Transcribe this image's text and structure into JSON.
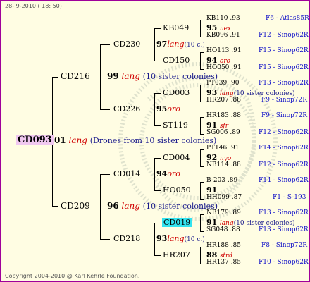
{
  "header": {
    "timestamp": "28- 9-2010 ( 18: 50)"
  },
  "footer": {
    "copyright": "Copyright 2004-2010 @ Karl Kehrle Foundation."
  },
  "root": {
    "id": "CD093",
    "num": "01",
    "race": "lang",
    "note": "(Drones from 10 sister colonies)"
  },
  "gen1": [
    {
      "id": "CD216",
      "num": "99",
      "race": "lang",
      "note": "(10 sister colonies)"
    },
    {
      "id": "CD209",
      "num": "96",
      "race": "lang",
      "note": "(10 sister colonies)"
    }
  ],
  "gen2": [
    {
      "id": "CD230",
      "num": "97",
      "race": "lang",
      "note": "(10 c.)"
    },
    {
      "id": "CD226",
      "num": "95",
      "race": "oro",
      "note": ""
    },
    {
      "id": "CD014",
      "num": "94",
      "race": "oro",
      "note": ""
    },
    {
      "id": "CD218",
      "num": "93",
      "race": "lang",
      "note": "(10 c.)"
    }
  ],
  "gen3": [
    {
      "id": "KB049",
      "num": "95",
      "race": "nex",
      "note": ""
    },
    {
      "id": "CD150",
      "num": "94",
      "race": "oro",
      "note": ""
    },
    {
      "id": "CD003",
      "num": "93",
      "race": "lang",
      "note": "(10 sister colonies)"
    },
    {
      "id": "ST119",
      "num": "91",
      "race": "sfr",
      "note": ""
    },
    {
      "id": "CD004",
      "num": "92",
      "race": "nyo",
      "note": ""
    },
    {
      "id": "HO050",
      "num": "91",
      "race": "",
      "note": ""
    },
    {
      "id": "CD019",
      "num": "91",
      "race": "lang",
      "note": "(10 sister colonies)"
    },
    {
      "id": "HR207",
      "num": "88",
      "race": "strd",
      "note": ""
    }
  ],
  "gen4": [
    {
      "id": "KB110",
      "val": ".93",
      "loc": "F6 - Atlas85R"
    },
    {
      "id": "KB096",
      "val": ".91",
      "loc": "F12 - Sinop62R"
    },
    {
      "id": "HO113",
      "val": ".91",
      "loc": "F15 - Sinop62R"
    },
    {
      "id": "HO050",
      "val": ".91",
      "loc": "F15 - Sinop62R"
    },
    {
      "id": "PT039",
      "val": ".90",
      "loc": "F13 - Sinop62R"
    },
    {
      "id": "HR207",
      "val": ".88",
      "loc": "F9 - Sinop72R"
    },
    {
      "id": "HR183",
      "val": ".88",
      "loc": "F9 - Sinop72R"
    },
    {
      "id": "SG006",
      "val": ".89",
      "loc": "F12 - Sinop62R"
    },
    {
      "id": "PT146",
      "val": ".91",
      "loc": "F14 - Sinop62R"
    },
    {
      "id": "NB114",
      "val": ".88",
      "loc": "F12 - Sinop62R"
    },
    {
      "id": "B-203",
      "val": ".89",
      "loc": "F14 - Sinop62R"
    },
    {
      "id": "HH099",
      "val": ".87",
      "loc": "F1 - S-193"
    },
    {
      "id": "NB179",
      "val": ".89",
      "loc": "F13 - Sinop62R"
    },
    {
      "id": "SG048",
      "val": ".88",
      "loc": "F13 - Sinop62R"
    },
    {
      "id": "HR188",
      "val": ".85",
      "loc": "F8 - Sinop72R"
    },
    {
      "id": "HR137",
      "val": ".85",
      "loc": "F10 - Sinop62R"
    }
  ],
  "colors": {
    "border": "#a0009a",
    "background": "#fffde3",
    "race": "#d00000",
    "location": "#1010c8",
    "highlight": "#33e3ef",
    "root_highlight": "#f0c8f0"
  }
}
